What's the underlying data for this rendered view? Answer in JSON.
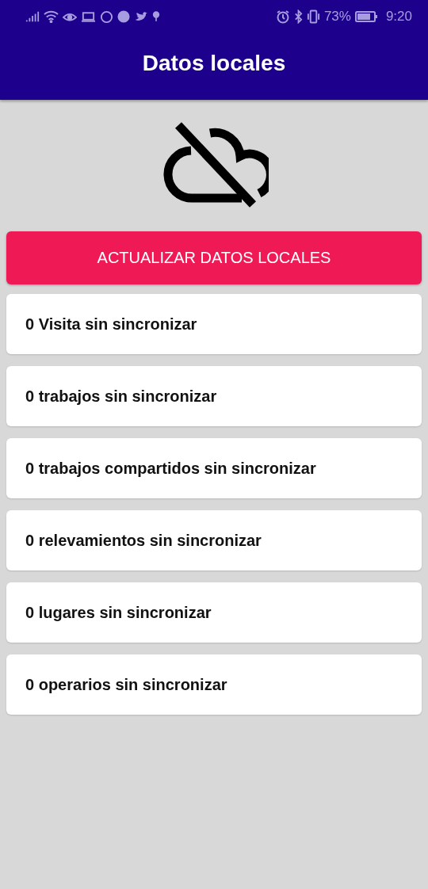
{
  "status_bar": {
    "battery": "73%",
    "time": "9:20"
  },
  "app_bar": {
    "title": "Datos locales"
  },
  "action_button": {
    "label": "ACTUALIZAR DATOS LOCALES"
  },
  "items": [
    {
      "label": "0 Visita sin sincronizar"
    },
    {
      "label": "0 trabajos sin sincronizar"
    },
    {
      "label": "0 trabajos compartidos sin sincronizar"
    },
    {
      "label": "0 relevamientos sin sincronizar"
    },
    {
      "label": "0 lugares sin sincronizar"
    },
    {
      "label": "0 operarios sin sincronizar"
    }
  ]
}
